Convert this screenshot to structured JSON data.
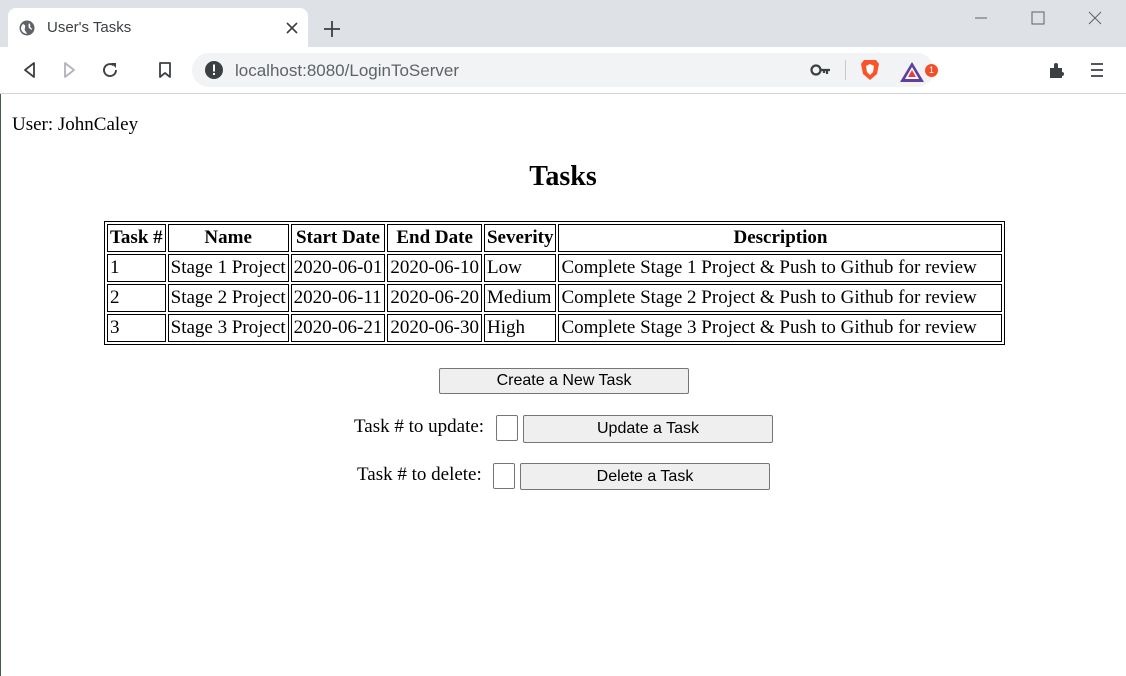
{
  "browser": {
    "tab_title": "User's Tasks",
    "url": "localhost:8080/LoginToServer",
    "extension_badge_count": "1"
  },
  "page": {
    "user_line": "User: JohnCaley",
    "heading": "Tasks",
    "table": {
      "headers": [
        "Task #",
        "Name",
        "Start Date",
        "End Date",
        "Severity",
        "Description"
      ],
      "rows": [
        [
          "1",
          "Stage 1 Project",
          "2020-06-01",
          "2020-06-10",
          "Low",
          "Complete Stage 1 Project & Push to Github for review"
        ],
        [
          "2",
          "Stage 2 Project",
          "2020-06-11",
          "2020-06-20",
          "Medium",
          "Complete Stage 2 Project & Push to Github for review"
        ],
        [
          "3",
          "Stage 3 Project",
          "2020-06-21",
          "2020-06-30",
          "High",
          "Complete Stage 3 Project & Push to Github for review"
        ]
      ]
    },
    "create_button": "Create a New Task",
    "update_label": "Task # to update:",
    "update_value": "",
    "update_button": "Update a Task",
    "delete_label": "Task # to delete:",
    "delete_value": "",
    "delete_button": "Delete a Task"
  }
}
